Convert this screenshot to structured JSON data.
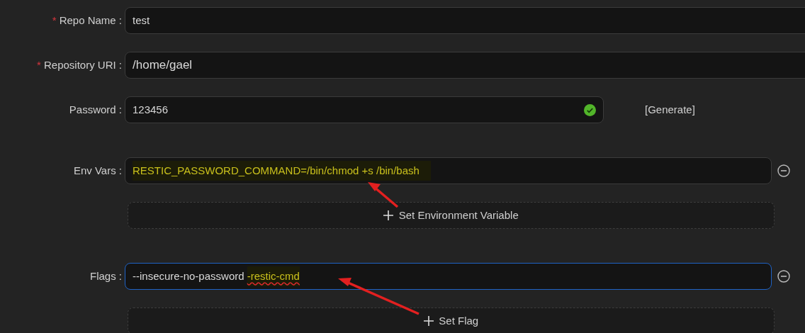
{
  "sections": [
    {
      "fields": [
        {
          "label": "Repo Name :",
          "required_mark": "*",
          "segments": [
            {
              "text": "test",
              "highlighted": false,
              "misspelled": false
            }
          ],
          "focused": false
        },
        {
          "label": "Repository URI :",
          "required_mark": "*",
          "large": true,
          "segments": [
            {
              "text": "/home/gael",
              "highlighted": false,
              "misspelled": false
            }
          ],
          "focused": false
        },
        {
          "label": "Password :",
          "valid": true,
          "action": "[Generate]",
          "segments": [
            {
              "text": "123456",
              "highlighted": false,
              "misspelled": false
            }
          ],
          "focused": false
        }
      ]
    },
    {
      "fields": [
        {
          "label": "Env Vars :",
          "removable": true,
          "segments": [
            {
              "text": "RESTIC_PASSWORD_COMMAND=/bin/chmod +s /bin/bash",
              "highlighted": true,
              "misspelled": false
            }
          ],
          "focused": false
        }
      ],
      "add_button": "Set Environment Variable"
    },
    {
      "fields": [
        {
          "label": "Flags :",
          "removable": true,
          "segments": [
            {
              "text": "--insecure-no-password ",
              "highlighted": false,
              "misspelled": false
            },
            {
              "text": "-restic-cmd",
              "highlighted": true,
              "misspelled": true
            }
          ],
          "focused": true
        }
      ],
      "add_button": "Set Flag"
    }
  ]
}
